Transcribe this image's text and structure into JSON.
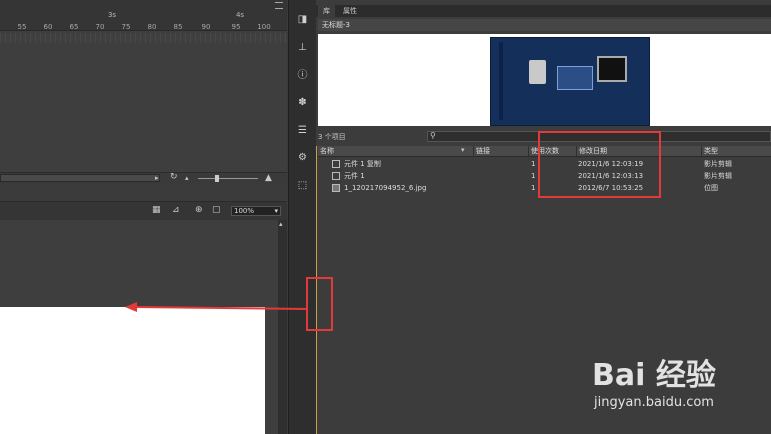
{
  "timeline": {
    "second_labels": [
      "3s",
      "4s"
    ],
    "frame_labels": [
      "55",
      "60",
      "65",
      "70",
      "75",
      "80",
      "85",
      "90",
      "95",
      "100"
    ],
    "stage_zoom": "100%"
  },
  "library": {
    "tabs": [
      "库",
      "属性"
    ],
    "document_name": "无标题-3",
    "item_count": "3 个项目",
    "columns": [
      "名称",
      "链接",
      "使用次数",
      "修改日期",
      "类型"
    ],
    "items": [
      {
        "name": "元件 1 复制",
        "uses": "1",
        "date": "2021/1/6 12:03:19",
        "type": "影片剪辑",
        "icon": "movieclip-icon"
      },
      {
        "name": "元件 1",
        "uses": "1",
        "date": "2021/1/6 12:03:13",
        "type": "影片剪辑",
        "icon": "movieclip-icon"
      },
      {
        "name": "1_120217094952_6.jpg",
        "uses": "1",
        "date": "2012/6/7 10:53:25",
        "type": "位图",
        "icon": "bitmap-icon"
      }
    ]
  },
  "watermark": {
    "logo_text": "Bai 经验",
    "url": "jingyan.baidu.com"
  },
  "colors": {
    "annotation": "#e23a3a",
    "panel": "#3c3c3c",
    "toolbar": "#2e2e2e"
  }
}
